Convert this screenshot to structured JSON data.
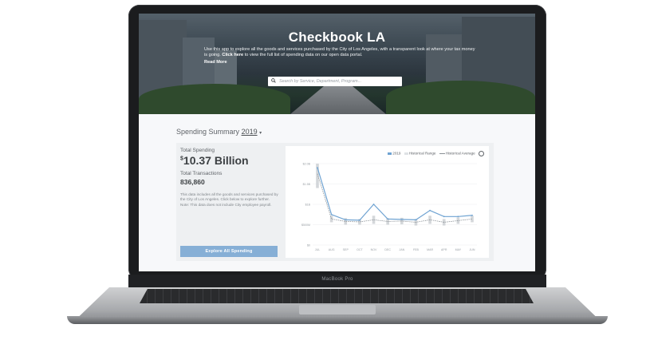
{
  "device": {
    "label": "MacBook Pro"
  },
  "hero": {
    "title": "Checkbook LA",
    "description_lead": "Use this app to explore all the goods and services purchased by the City of Los Angeles, with a transparent look at where your tax money is going.",
    "description_link": "Click here",
    "description_tail": "to view the full list of spending data on our open data portal.",
    "read_more": "Read More"
  },
  "search": {
    "placeholder": "Search by Service, Department, Program..."
  },
  "summary": {
    "title_prefix": "Spending Summary",
    "year": "2019",
    "total_spending_label": "Total Spending",
    "total_spending_currency": "$",
    "total_spending_value": "10.37 Billion",
    "total_transactions_label": "Total Transactions",
    "total_transactions_value": "836,860",
    "note": "This data includes all the goods and services purchased by the City of Los Angeles. Click below to explore further. Note: This data does not include City employee payroll.",
    "explore_button": "Explore All Spending"
  },
  "colors": {
    "series_2019": "#6fa3d2",
    "range": "#c9cdd1",
    "average": "#8a9096",
    "button": "#86afd6"
  },
  "chart_data": {
    "type": "line",
    "legend": [
      "2019",
      "Historical Range",
      "Historical Average"
    ],
    "legend_placement": "top-right",
    "x": [
      "JUL",
      "AUG",
      "SEP",
      "OCT",
      "NOV",
      "DEC",
      "JAN",
      "FEB",
      "MAR",
      "APR",
      "MAY",
      "JUN"
    ],
    "y_ticks": [
      "$0",
      "$500M",
      "$1B",
      "$1.5B",
      "$2.0B"
    ],
    "ylim": [
      0,
      2000000000
    ],
    "series": [
      {
        "name": "2019",
        "values": [
          1900000000,
          750000000,
          620000000,
          610000000,
          1000000000,
          640000000,
          630000000,
          620000000,
          850000000,
          700000000,
          700000000,
          730000000
        ]
      },
      {
        "name": "Historical Average",
        "values": [
          1750000000,
          640000000,
          580000000,
          570000000,
          620000000,
          580000000,
          590000000,
          560000000,
          620000000,
          560000000,
          600000000,
          640000000
        ]
      }
    ],
    "range_low": [
      1400000000,
      560000000,
      500000000,
      500000000,
      520000000,
      500000000,
      510000000,
      480000000,
      520000000,
      480000000,
      520000000,
      560000000
    ],
    "range_high": [
      2000000000,
      720000000,
      660000000,
      640000000,
      720000000,
      660000000,
      670000000,
      640000000,
      720000000,
      640000000,
      680000000,
      720000000
    ]
  }
}
